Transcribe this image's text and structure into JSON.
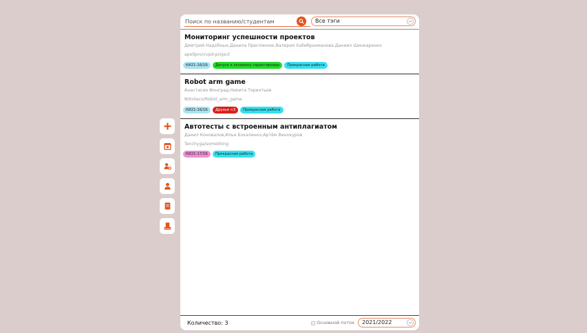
{
  "colors": {
    "background": "#dccdcd",
    "accent": "#e2531b",
    "toolbar_icon": "#e2531b"
  },
  "toolbar": {
    "icons": [
      "plus-icon",
      "calendar-icon",
      "user-settings-icon",
      "user-icon",
      "document-icon",
      "stamp-icon"
    ]
  },
  "search": {
    "placeholder": "Поиск по названию/студентам",
    "value": ""
  },
  "tags_filter": {
    "selected": "Все тэги"
  },
  "projects": [
    {
      "title": "Мониторинг успешности проектов",
      "students": "Дмитрий Надобных,Данила Присяжнюк,Валерия Хабибрахманова,Даниил Шинкаренко",
      "repo": "apellpro/vvpd-project",
      "tags": [
        {
          "label": "КИ21-16/1Б",
          "color": "#a9e3f3"
        },
        {
          "label": "Допуск к экзамену гарантирован",
          "color": "#23d92a"
        },
        {
          "label": "Прекрасная работа",
          "color": "#35e0f0"
        }
      ]
    },
    {
      "title": "Robot arm game",
      "students": "Анастасия Фонград,Никита Терентьев",
      "repo": "Nitrolaco/Robot_arm_game",
      "tags": [
        {
          "label": "КИ21-16/1Б",
          "color": "#a9e3f3"
        },
        {
          "label": "Друзья <3",
          "color": "#d8211b"
        },
        {
          "label": "Прекрасная работа",
          "color": "#35e0f0"
        }
      ]
    },
    {
      "title": "Автотесты с встроенным антиплагиатом",
      "students": "Данил Коновалов,Илья Бокаленко,Артём Винокуров",
      "repo": "Tenchyga/something",
      "tags": [
        {
          "label": "КИ21-17/1Б",
          "color": "#ec8fd4"
        },
        {
          "label": "Прекрасная работа",
          "color": "#35e0f0"
        }
      ]
    }
  ],
  "footer": {
    "count_label": "Количество: 3",
    "stream_label": "Основной поток",
    "stream_checked": false,
    "year_selected": "2021/2022"
  }
}
